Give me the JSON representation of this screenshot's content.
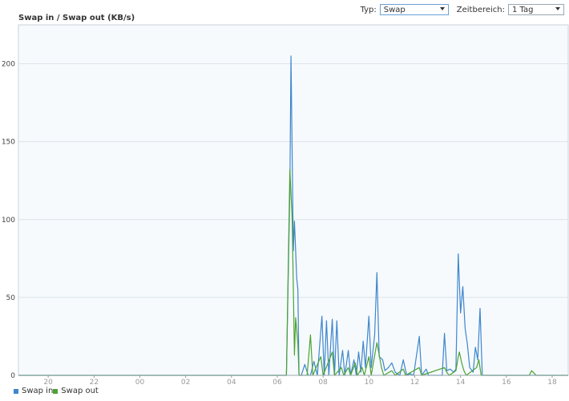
{
  "toolbar": {
    "type_label": "Typ:",
    "type_value": "Swap",
    "range_label": "Zeitbereich:",
    "range_value": "1 Tag"
  },
  "colors": {
    "swap_in": "#3f86cc",
    "swap_out": "#4ca232",
    "plot_bg": "#f6fafd",
    "grid": "#dde3ea"
  },
  "chart_data": {
    "type": "line",
    "title": "Swap in / Swap out (KB/s)",
    "xlabel": "",
    "ylabel": "",
    "x_ticks": [
      "20",
      "22",
      "00",
      "02",
      "04",
      "06",
      "08",
      "10",
      "12",
      "14",
      "16",
      "18"
    ],
    "x_range_hours": [
      18.7,
      42.7
    ],
    "ylim": [
      0,
      225
    ],
    "y_ticks": [
      0,
      50,
      100,
      150,
      200
    ],
    "grid": true,
    "legend": "bottom-left",
    "series": [
      {
        "name": "Swap in",
        "points": [
          [
            18.7,
            0
          ],
          [
            30.4,
            0
          ],
          [
            30.55,
            120
          ],
          [
            30.6,
            205
          ],
          [
            30.7,
            80
          ],
          [
            30.75,
            99
          ],
          [
            30.85,
            62
          ],
          [
            30.9,
            55
          ],
          [
            30.95,
            0
          ],
          [
            31.05,
            0
          ],
          [
            31.2,
            7
          ],
          [
            31.35,
            0
          ],
          [
            31.45,
            0
          ],
          [
            31.6,
            9
          ],
          [
            31.75,
            0
          ],
          [
            31.95,
            38
          ],
          [
            32.05,
            0
          ],
          [
            32.15,
            35
          ],
          [
            32.25,
            0
          ],
          [
            32.4,
            36
          ],
          [
            32.5,
            0
          ],
          [
            32.6,
            35
          ],
          [
            32.7,
            0
          ],
          [
            32.85,
            16
          ],
          [
            32.95,
            0
          ],
          [
            33.1,
            16
          ],
          [
            33.2,
            0
          ],
          [
            33.35,
            10
          ],
          [
            33.45,
            0
          ],
          [
            33.55,
            15
          ],
          [
            33.65,
            2
          ],
          [
            33.75,
            22
          ],
          [
            33.85,
            5
          ],
          [
            34.0,
            38
          ],
          [
            34.1,
            5
          ],
          [
            34.25,
            26
          ],
          [
            34.35,
            66
          ],
          [
            34.45,
            12
          ],
          [
            34.6,
            10
          ],
          [
            34.7,
            3
          ],
          [
            34.85,
            5
          ],
          [
            35.0,
            8
          ],
          [
            35.15,
            2
          ],
          [
            35.35,
            0
          ],
          [
            35.5,
            10
          ],
          [
            35.65,
            0
          ],
          [
            35.8,
            1
          ],
          [
            35.95,
            0
          ],
          [
            36.2,
            25
          ],
          [
            36.3,
            0
          ],
          [
            36.5,
            4
          ],
          [
            36.6,
            0
          ],
          [
            37.2,
            0
          ],
          [
            37.3,
            27
          ],
          [
            37.4,
            3
          ],
          [
            37.55,
            4
          ],
          [
            37.7,
            2
          ],
          [
            37.8,
            4
          ],
          [
            37.9,
            78
          ],
          [
            38.0,
            40
          ],
          [
            38.1,
            57
          ],
          [
            38.2,
            30
          ],
          [
            38.3,
            20
          ],
          [
            38.4,
            5
          ],
          [
            38.55,
            2
          ],
          [
            38.65,
            18
          ],
          [
            38.75,
            10
          ],
          [
            38.85,
            43
          ],
          [
            38.95,
            0
          ],
          [
            39.2,
            0
          ],
          [
            42.7,
            0
          ]
        ]
      },
      {
        "name": "Swap out",
        "points": [
          [
            18.7,
            0
          ],
          [
            30.4,
            0
          ],
          [
            30.55,
            132
          ],
          [
            30.65,
            100
          ],
          [
            30.75,
            13
          ],
          [
            30.8,
            37
          ],
          [
            30.9,
            20
          ],
          [
            30.95,
            0
          ],
          [
            31.05,
            0
          ],
          [
            31.3,
            0
          ],
          [
            31.45,
            26
          ],
          [
            31.55,
            0
          ],
          [
            31.9,
            12
          ],
          [
            32.0,
            0
          ],
          [
            32.4,
            15
          ],
          [
            32.5,
            0
          ],
          [
            32.8,
            5
          ],
          [
            32.9,
            0
          ],
          [
            33.1,
            5
          ],
          [
            33.2,
            0
          ],
          [
            33.4,
            8
          ],
          [
            33.5,
            0
          ],
          [
            33.7,
            5
          ],
          [
            33.8,
            0
          ],
          [
            34.0,
            12
          ],
          [
            34.1,
            0
          ],
          [
            34.35,
            21
          ],
          [
            34.45,
            13
          ],
          [
            34.55,
            5
          ],
          [
            34.65,
            0
          ],
          [
            35.0,
            3
          ],
          [
            35.15,
            0
          ],
          [
            35.5,
            4
          ],
          [
            35.6,
            0
          ],
          [
            36.2,
            5
          ],
          [
            36.3,
            0
          ],
          [
            37.3,
            5
          ],
          [
            37.4,
            2
          ],
          [
            37.5,
            0
          ],
          [
            37.8,
            3
          ],
          [
            37.9,
            12
          ],
          [
            37.95,
            15
          ],
          [
            38.05,
            8
          ],
          [
            38.15,
            3
          ],
          [
            38.25,
            0
          ],
          [
            38.7,
            5
          ],
          [
            38.8,
            10
          ],
          [
            38.9,
            0
          ],
          [
            41.0,
            0
          ],
          [
            41.1,
            3
          ],
          [
            41.3,
            0
          ],
          [
            42.7,
            0
          ]
        ]
      }
    ]
  }
}
